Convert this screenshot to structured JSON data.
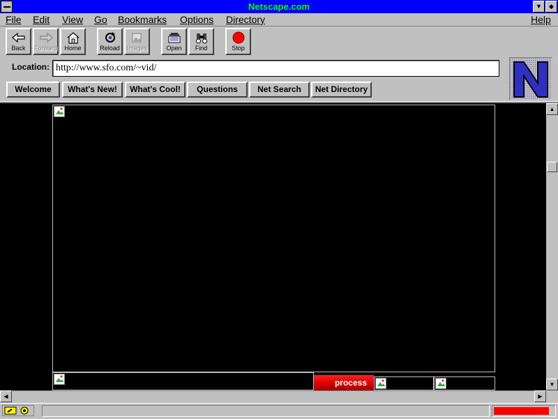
{
  "window": {
    "title": "Netscape.com",
    "title_color": "#00ff00",
    "titlebar_color": "#0000ff"
  },
  "menu": {
    "items": [
      {
        "label": "File"
      },
      {
        "label": "Edit"
      },
      {
        "label": "View"
      },
      {
        "label": "Go"
      },
      {
        "label": "Bookmarks"
      },
      {
        "label": "Options"
      },
      {
        "label": "Directory"
      },
      {
        "label": "Help"
      }
    ]
  },
  "toolbar": {
    "buttons": [
      {
        "label": "Back",
        "icon": "back-arrow-icon",
        "enabled": true
      },
      {
        "label": "Forward",
        "icon": "forward-arrow-icon",
        "enabled": false
      },
      {
        "label": "Home",
        "icon": "home-icon",
        "enabled": true
      },
      {
        "label": "Reload",
        "icon": "reload-icon",
        "enabled": true
      },
      {
        "label": "Images",
        "icon": "images-icon",
        "enabled": false
      },
      {
        "label": "Open",
        "icon": "open-icon",
        "enabled": true
      },
      {
        "label": "Find",
        "icon": "binoculars-icon",
        "enabled": true
      },
      {
        "label": "Stop",
        "icon": "stop-icon",
        "enabled": true
      }
    ]
  },
  "location": {
    "label": "Location:",
    "url": "http://www.sfo.com/~vid/"
  },
  "directory_buttons": [
    {
      "label": "Welcome"
    },
    {
      "label": "What's New!"
    },
    {
      "label": "What's Cool!"
    },
    {
      "label": "Questions"
    },
    {
      "label": "Net Search"
    },
    {
      "label": "Net Directory"
    }
  ],
  "page": {
    "background": "#000000",
    "process_button": "process",
    "process_color": "#e00000"
  },
  "statusbar": {
    "text": "",
    "progress": 0.92,
    "progress_color": "#ff0000"
  }
}
